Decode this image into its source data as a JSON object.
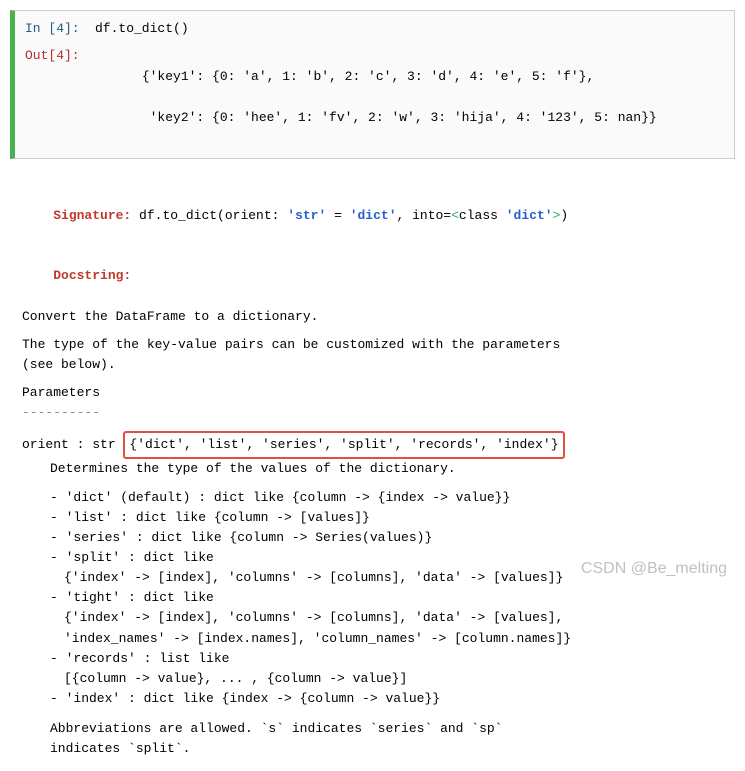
{
  "cell": {
    "in_prompt": "In  [4]:",
    "out_prompt": "Out[4]:",
    "code": "df.to_dict()",
    "out_line1": "{'key1': {0: 'a', 1: 'b', 2: 'c', 3: 'd', 4: 'e', 5: 'f'},",
    "out_line2": " 'key2': {0: 'hee', 1: 'fv', 2: 'w', 3: 'hija', 4: '123', 5: nan}}"
  },
  "sig": {
    "label": "Signature:",
    "func": " df.to_dict(orient: ",
    "str_q": "'str'",
    "eq": " = ",
    "dict_q": "'dict'",
    "into": ", into=",
    "lt": "<",
    "cls": "class ",
    "dict_q2": "'dict'",
    "gt": ">",
    "close": ")"
  },
  "docstring_label": "Docstring:",
  "doc": {
    "summary": "Convert the DataFrame to a dictionary.",
    "desc1": "The type of the key-value pairs can be customized with the parameters",
    "desc2": "(see below).",
    "params_header": "Parameters",
    "params_underline": "----------",
    "orient_label": "orient : str ",
    "orient_opts": "{'dict', 'list', 'series', 'split', 'records', 'index'}",
    "orient_desc": "Determines the type of the values of the dictionary.",
    "opt_dict": "- 'dict' (default) : dict like {column -> {index -> value}}",
    "opt_list": "- 'list' : dict like {column -> [values]}",
    "opt_series": "- 'series' : dict like {column -> Series(values)}",
    "opt_split": "- 'split' : dict like",
    "opt_split2": "{'index' -> [index], 'columns' -> [columns], 'data' -> [values]}",
    "opt_tight": "- 'tight' : dict like",
    "opt_tight2": "{'index' -> [index], 'columns' -> [columns], 'data' -> [values],",
    "opt_tight3": "'index_names' -> [index.names], 'column_names' -> [column.names]}",
    "opt_records": "- 'records' : list like",
    "opt_records2": "[{column -> value}, ... , {column -> value}]",
    "opt_index": "- 'index' : dict like {index -> {column -> value}}",
    "abbrev1": "Abbreviations are allowed. `s` indicates `series` and `sp`",
    "abbrev2": "indicates `split`."
  },
  "watermark": "CSDN @Be_melting"
}
